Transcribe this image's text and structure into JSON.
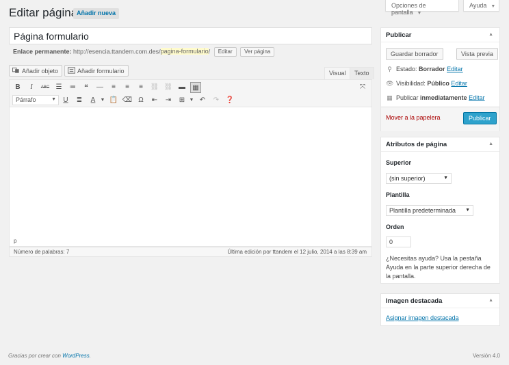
{
  "screen_meta": {
    "options_label": "Opciones de pantalla",
    "help_label": "Ayuda"
  },
  "header": {
    "title": "Editar página",
    "add_new": "Añadir nueva"
  },
  "post": {
    "title_value": "Página formulario",
    "permalink_label": "Enlace permanente:",
    "permalink_base": "http://esencia.ttandem.com.des/",
    "permalink_slug": "pagina-formulario",
    "permalink_tail": "/",
    "edit_label": "Editar",
    "view_label": "Ver página"
  },
  "media": {
    "add_object": "Añadir objeto",
    "add_form": "Añadir formulario"
  },
  "editor_tabs": {
    "visual": "Visual",
    "text": "Texto"
  },
  "toolbar": {
    "format_value": "Párrafo"
  },
  "editor": {
    "path": "p",
    "word_count": "Número de palabras: 7",
    "last_edit": "Última edición por ttandem el 12 julio, 2014 a las 8:39 am"
  },
  "publish": {
    "title": "Publicar",
    "save_draft": "Guardar borrador",
    "preview": "Vista previa",
    "status_label": "Estado:",
    "status_value": "Borrador",
    "visibility_label": "Visibilidad:",
    "visibility_value": "Público",
    "publish_label": "Publicar",
    "publish_value": "inmediatamente",
    "edit_link": "Editar",
    "trash": "Mover a la papelera",
    "publish_button": "Publicar"
  },
  "attributes": {
    "title": "Atributos de página",
    "parent_label": "Superior",
    "parent_value": "(sin superior)",
    "template_label": "Plantilla",
    "template_value": "Plantilla predeterminada",
    "order_label": "Orden",
    "order_value": "0",
    "help_text": "¿Necesitas ayuda? Usa la pestaña Ayuda en la parte superior derecha de la pantalla."
  },
  "featured": {
    "title": "Imagen destacada",
    "set_link": "Asignar imagen destacada"
  },
  "footer": {
    "credit_prefix": "Gracias por crear con ",
    "credit_link": "WordPress",
    "credit_suffix": ".",
    "version": "Versión 4.0"
  },
  "colors": {
    "accent": "#0073aa",
    "primary_button": "#2ea2cc",
    "danger": "#aa0000",
    "background": "#f1f1f1"
  }
}
